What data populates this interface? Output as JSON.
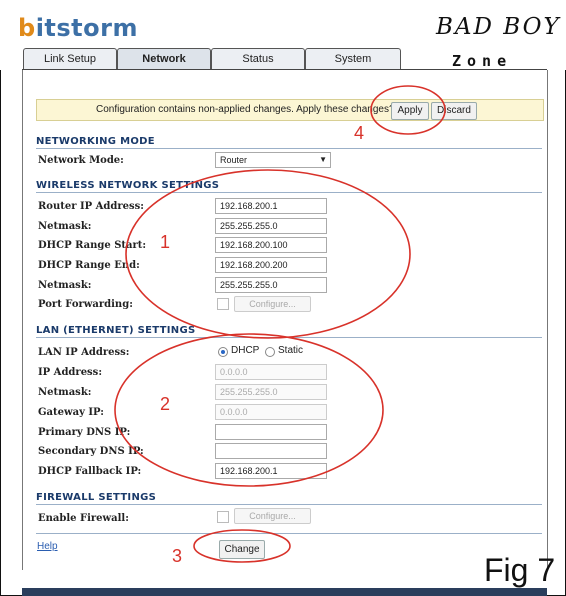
{
  "brand": {
    "logo_prefix": "b",
    "logo_rest": "itstorm",
    "overlay_title": "BAD BOY",
    "overlay_subtitle": "Zone",
    "figure_label": "Fig 7"
  },
  "tabs": [
    {
      "label": "Link Setup"
    },
    {
      "label": "Network"
    },
    {
      "label": "Status"
    },
    {
      "label": "System"
    }
  ],
  "notice": {
    "message": "Configuration contains non-applied changes. Apply these changes?",
    "apply_label": "Apply",
    "discard_label": "Discard"
  },
  "networking_mode": {
    "heading": "NETWORKING MODE",
    "mode_label": "Network Mode:",
    "mode_value": "Router"
  },
  "wireless": {
    "heading": "WIRELESS NETWORK SETTINGS",
    "router_ip_label": "Router IP Address:",
    "router_ip": "192.168.200.1",
    "netmask_label": "Netmask:",
    "netmask": "255.255.255.0",
    "dhcp_start_label": "DHCP Range Start:",
    "dhcp_start": "192.168.200.100",
    "dhcp_end_label": "DHCP Range End:",
    "dhcp_end": "192.168.200.200",
    "netmask2_label": "Netmask:",
    "netmask2": "255.255.255.0",
    "port_forwarding_label": "Port Forwarding:",
    "configure_label": "Configure..."
  },
  "lan": {
    "heading": "LAN (ETHERNET) SETTINGS",
    "lan_ip_label": "LAN IP Address:",
    "dhcp_option": "DHCP",
    "static_option": "Static",
    "ip_label": "IP Address:",
    "ip_placeholder": "0.0.0.0",
    "netmask_label": "Netmask:",
    "netmask_placeholder": "255.255.255.0",
    "gateway_label": "Gateway IP:",
    "gateway_placeholder": "0.0.0.0",
    "primary_dns_label": "Primary DNS IP:",
    "primary_dns": "",
    "secondary_dns_label": "Secondary DNS IP:",
    "secondary_dns": "",
    "fallback_label": "DHCP Fallback IP:",
    "fallback_ip": "192.168.200.1"
  },
  "firewall": {
    "heading": "FIREWALL SETTINGS",
    "enable_label": "Enable Firewall:",
    "configure_label": "Configure..."
  },
  "footer": {
    "help_label": "Help",
    "change_label": "Change"
  },
  "annotations": {
    "n1": "1",
    "n2": "2",
    "n3": "3",
    "n4": "4",
    "color": "#d8322a"
  }
}
